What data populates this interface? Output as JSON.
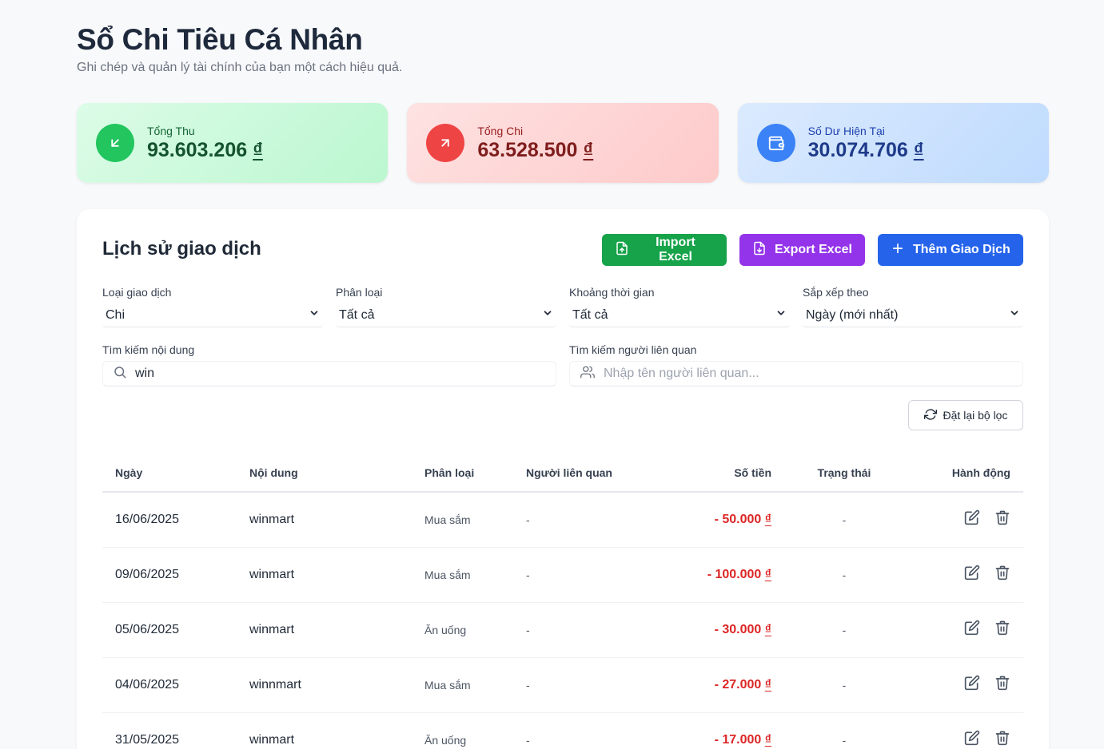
{
  "header": {
    "title": "Sổ Chi Tiêu Cá Nhân",
    "subtitle": "Ghi chép và quản lý tài chính của bạn một cách hiệu quả."
  },
  "summary": {
    "income": {
      "label": "Tổng Thu",
      "amount": "93.603.206",
      "currency": "₫",
      "icon": "arrow-down-left-icon"
    },
    "expense": {
      "label": "Tổng Chi",
      "amount": "63.528.500",
      "currency": "₫",
      "icon": "arrow-up-right-icon"
    },
    "balance": {
      "label": "Số Dư Hiện Tại",
      "amount": "30.074.706",
      "currency": "₫",
      "icon": "wallet-icon"
    }
  },
  "panel": {
    "title": "Lịch sử giao dịch",
    "import_label": "Import Excel",
    "export_label": "Export Excel",
    "add_label": "Thêm Giao Dịch"
  },
  "filters": {
    "type": {
      "label": "Loại giao dịch",
      "value": "Chi"
    },
    "category": {
      "label": "Phân loại",
      "value": "Tất cả"
    },
    "period": {
      "label": "Khoảng thời gian",
      "value": "Tất cả"
    },
    "sort": {
      "label": "Sắp xếp theo",
      "value": "Ngày (mới nhất)"
    },
    "content_search": {
      "label": "Tìm kiếm nội dung",
      "value": "win"
    },
    "person_search": {
      "label": "Tìm kiếm người liên quan",
      "placeholder": "Nhập tên người liên quan..."
    },
    "reset_label": "Đặt lại bộ lọc"
  },
  "table": {
    "headers": {
      "date": "Ngày",
      "content": "Nội dung",
      "category": "Phân loại",
      "person": "Người liên quan",
      "amount": "Số tiền",
      "status": "Trạng thái",
      "actions": "Hành động"
    },
    "rows": [
      {
        "date": "16/06/2025",
        "content": "winmart",
        "category": "Mua sắm",
        "person": "-",
        "amount": "- 50.000",
        "currency": "₫",
        "status": "-"
      },
      {
        "date": "09/06/2025",
        "content": "winmart",
        "category": "Mua sắm",
        "person": "-",
        "amount": "- 100.000",
        "currency": "₫",
        "status": "-"
      },
      {
        "date": "05/06/2025",
        "content": "winmart",
        "category": "Ăn uống",
        "person": "-",
        "amount": "- 30.000",
        "currency": "₫",
        "status": "-"
      },
      {
        "date": "04/06/2025",
        "content": "winnmart",
        "category": "Mua sắm",
        "person": "-",
        "amount": "- 27.000",
        "currency": "₫",
        "status": "-"
      },
      {
        "date": "31/05/2025",
        "content": "winmart",
        "category": "Ăn uống",
        "person": "-",
        "amount": "- 17.000",
        "currency": "₫",
        "status": "-"
      }
    ]
  },
  "colors": {
    "income": "#22c55e",
    "expense": "#ef4444",
    "balance": "#3b82f6",
    "import_btn": "#16a34a",
    "export_btn": "#9333ea",
    "add_btn": "#2563eb",
    "amount_negative": "#dc2626"
  }
}
